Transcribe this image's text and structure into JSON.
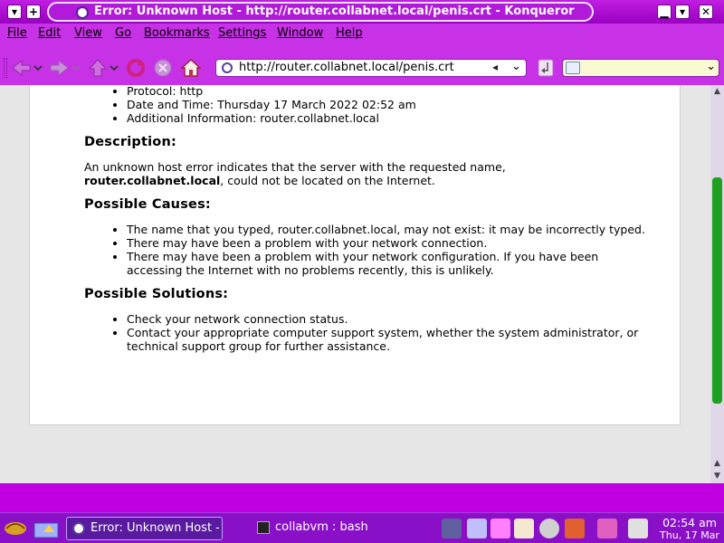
{
  "window": {
    "title": "Error: Unknown Host - http://router.collabnet.local/penis.crt - Konqueror",
    "buttons": {
      "menu": "▾",
      "sticky": "+",
      "minimize": "▁",
      "maximize": "▾",
      "close": "✕"
    }
  },
  "menubar": {
    "items": [
      "File",
      "Edit",
      "View",
      "Go",
      "Bookmarks",
      "Settings",
      "Window",
      "Help"
    ]
  },
  "toolbar": {
    "url": "http://router.collabnet.local/penis.crt",
    "search_value": ""
  },
  "page": {
    "info_items": [
      "Protocol: http",
      "Date and Time: Thursday 17 March 2022 02:52 am",
      "Additional Information: router.collabnet.local"
    ],
    "description_heading": "Description:",
    "description_line1": "An unknown host error indicates that the server with the requested name,",
    "description_host": "router.collabnet.local",
    "description_line2": ", could not be located on the Internet.",
    "causes_heading": "Possible Causes:",
    "causes": [
      "The name that you typed, router.collabnet.local, may not exist: it may be incorrectly typed.",
      "There may have been a problem with your network connection.",
      "There may have been a problem with your network configuration. If you have been accessing the Internet with no problems recently, this is unlikely."
    ],
    "solutions_heading": "Possible Solutions:",
    "solutions": [
      "Check your network connection status.",
      "Contact your appropriate computer support system, whether the system administrator, or technical support group for further assistance."
    ]
  },
  "scrollbar": {
    "position_fraction": 0.6
  },
  "taskbar": {
    "tasks": [
      {
        "label": "Error: Unknown Host - http://router.collabnet.local/penis.crt - Konqueror",
        "active": true
      },
      {
        "label": "collabvm : bash",
        "active": false
      }
    ],
    "clock_time": "02:54 am",
    "clock_date": "Thu, 17 Mar"
  },
  "colors": {
    "accent": "#c832e6",
    "taskbar": "#8a10c8",
    "scroll_thumb": "#1ea020"
  }
}
